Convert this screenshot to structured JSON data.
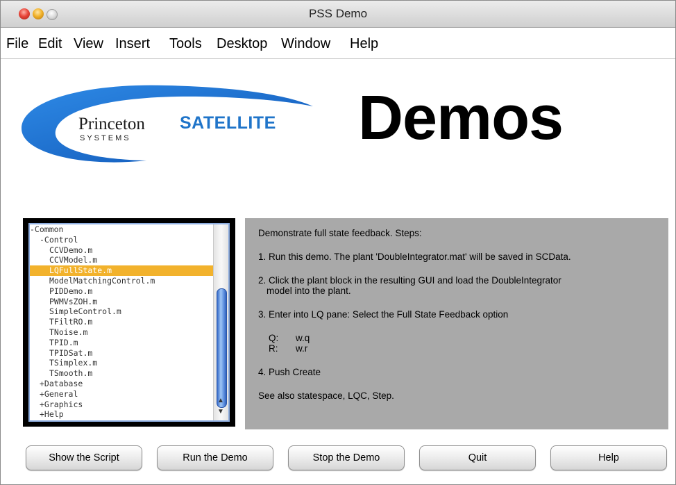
{
  "window": {
    "title": "PSS Demo"
  },
  "menu": [
    "File",
    "Edit",
    "View",
    "Insert",
    "Tools",
    "Desktop",
    "Window",
    "Help"
  ],
  "logo": {
    "name_part1": "Princeton",
    "name_part2": "SATELLITE",
    "sub": "SYSTEMS"
  },
  "header": {
    "title": "Demos"
  },
  "tree": {
    "items": [
      {
        "label": "-Common",
        "indent": 0
      },
      {
        "label": "-Control",
        "indent": 1
      },
      {
        "label": "CCVDemo.m",
        "indent": 2
      },
      {
        "label": "CCVModel.m",
        "indent": 2
      },
      {
        "label": "LQFullState.m",
        "indent": 2,
        "selected": true
      },
      {
        "label": "ModelMatchingControl.m",
        "indent": 2
      },
      {
        "label": "PIDDemo.m",
        "indent": 2
      },
      {
        "label": "PWMVsZOH.m",
        "indent": 2
      },
      {
        "label": "SimpleControl.m",
        "indent": 2
      },
      {
        "label": "TFiltRO.m",
        "indent": 2
      },
      {
        "label": "TNoise.m",
        "indent": 2
      },
      {
        "label": "TPID.m",
        "indent": 2
      },
      {
        "label": "TPIDSat.m",
        "indent": 2
      },
      {
        "label": "TSimplex.m",
        "indent": 2
      },
      {
        "label": "TSmooth.m",
        "indent": 2
      },
      {
        "label": "+Database",
        "indent": 1
      },
      {
        "label": "+General",
        "indent": 1
      },
      {
        "label": "+Graphics",
        "indent": 1
      },
      {
        "label": "+Help",
        "indent": 1
      }
    ]
  },
  "description": {
    "lines": [
      "Demonstrate full state feedback. Steps:",
      "1. Run this demo. The plant 'DoubleIntegrator.mat' will be saved in SCData.",
      "2. Click the plant block in the resulting GUI and load the DoubleIntegrator",
      "model into the plant.",
      "3. Enter into LQ pane: Select the Full State Feedback option",
      "Q:",
      "w.q",
      "R:",
      "w.r",
      "4. Push Create",
      "See also statespace, LQC, Step."
    ]
  },
  "buttons": {
    "show_script": "Show the Script",
    "run_demo": "Run the Demo",
    "stop_demo": "Stop the Demo",
    "quit": "Quit",
    "help": "Help"
  },
  "colors": {
    "selection": "#f2b22c",
    "panel": "#a9a9a9",
    "logo_blue": "#1f74c9"
  }
}
